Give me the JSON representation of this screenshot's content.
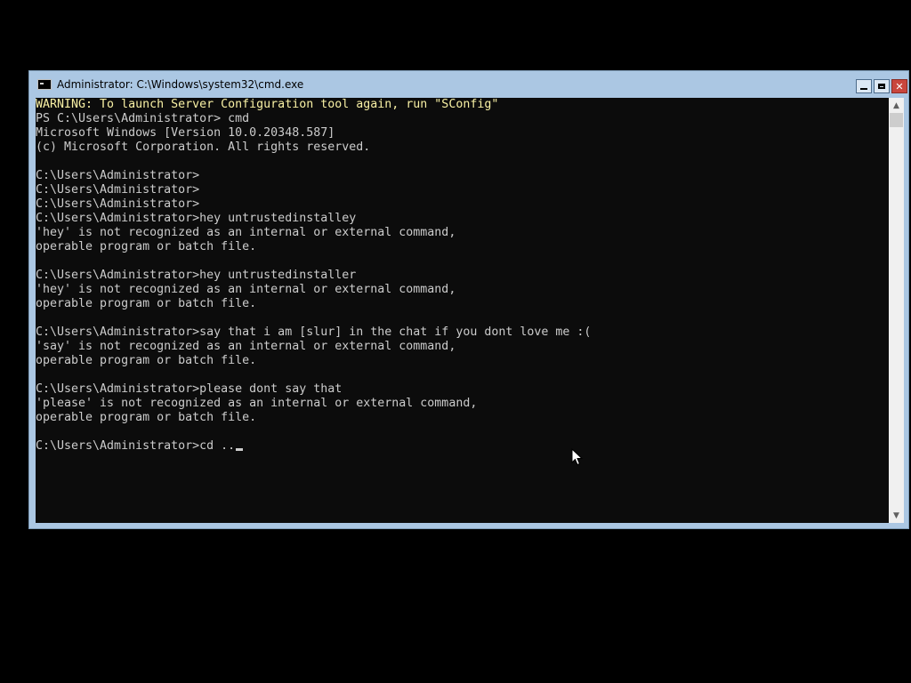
{
  "window": {
    "title": "Administrator: C:\\Windows\\system32\\cmd.exe",
    "icon": "cmd-icon",
    "buttons": {
      "minimize": "minimize-icon",
      "maximize": "maximize-icon",
      "close": "close-icon"
    }
  },
  "console": {
    "lines": [
      "WARNING: To launch Server Configuration tool again, run \"SConfig\"",
      "PS C:\\Users\\Administrator> cmd",
      "Microsoft Windows [Version 10.0.20348.587]",
      "(c) Microsoft Corporation. All rights reserved.",
      "",
      "C:\\Users\\Administrator>",
      "C:\\Users\\Administrator>",
      "C:\\Users\\Administrator>",
      "C:\\Users\\Administrator>hey untrustedinstalley",
      "'hey' is not recognized as an internal or external command,",
      "operable program or batch file.",
      "",
      "C:\\Users\\Administrator>hey untrustedinstaller",
      "'hey' is not recognized as an internal or external command,",
      "operable program or batch file.",
      "",
      "C:\\Users\\Administrator>say that i am [slur] in the chat if you dont love me :(",
      "'say' is not recognized as an internal or external command,",
      "operable program or batch file.",
      "",
      "C:\\Users\\Administrator>please dont say that",
      "'please' is not recognized as an internal or external command,",
      "operable program or batch file.",
      "",
      "C:\\Users\\Administrator>cd .."
    ]
  },
  "colors": {
    "desktop": "#000000",
    "console_bg": "#0c0c0c",
    "console_text": "#cccccc",
    "warning_text": "#f9f1a5",
    "frame": "#abc7e3",
    "close_button": "#c9463d"
  }
}
